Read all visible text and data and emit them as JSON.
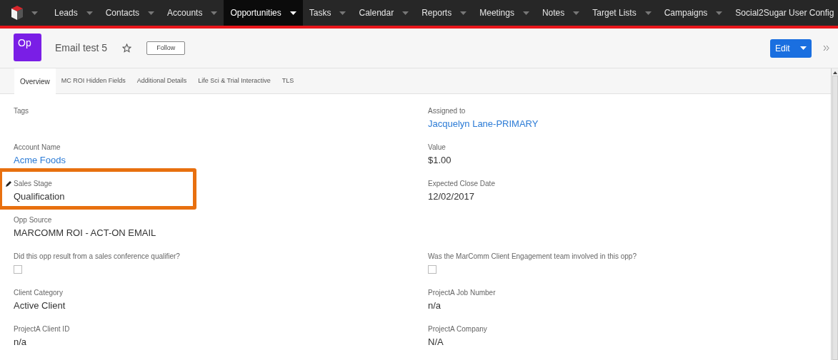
{
  "nav": {
    "items": [
      {
        "label": "Leads",
        "selected": false
      },
      {
        "label": "Contacts",
        "selected": false
      },
      {
        "label": "Accounts",
        "selected": false
      },
      {
        "label": "Opportunities",
        "selected": true
      },
      {
        "label": "Tasks",
        "selected": false
      },
      {
        "label": "Calendar",
        "selected": false
      },
      {
        "label": "Reports",
        "selected": false
      },
      {
        "label": "Meetings",
        "selected": false
      },
      {
        "label": "Notes",
        "selected": false
      },
      {
        "label": "Target Lists",
        "selected": false
      },
      {
        "label": "Campaigns",
        "selected": false
      },
      {
        "label": "Social2Sugar User Config",
        "selected": false
      }
    ]
  },
  "header": {
    "badge": "Op",
    "title": "Email test 5",
    "starred": false,
    "follow_button": "Follow",
    "edit_button": "Edit"
  },
  "tabs": [
    {
      "label": "Overview",
      "selected": true
    },
    {
      "label": "MC ROI Hidden Fields",
      "selected": false
    },
    {
      "label": "Additional Details",
      "selected": false
    },
    {
      "label": "Life Sci & Trial Interactive",
      "selected": false
    },
    {
      "label": "TLS",
      "selected": false
    }
  ],
  "rows": [
    {
      "left": {
        "label": "Tags",
        "kind": "text",
        "highlighted": false
      },
      "right": {
        "label": "Assigned to",
        "kind": "link",
        "value": "Jacquelyn Lane-PRIMARY",
        "highlighted": false
      }
    },
    {
      "left": {
        "label": "Account Name",
        "kind": "link",
        "value": "Acme Foods",
        "highlighted": false
      },
      "right": {
        "label": "Value",
        "kind": "text",
        "value": "$1.00",
        "highlighted": false
      }
    },
    {
      "left": {
        "label": "Sales Stage",
        "kind": "text",
        "value": "Qualification",
        "highlighted": true
      },
      "right": {
        "label": "Expected Close Date",
        "kind": "text",
        "value": "12/02/2017",
        "highlighted": false
      }
    },
    {
      "left": {
        "label": "Opp Source",
        "kind": "text",
        "value": "MARCOMM ROI - ACT-ON EMAIL",
        "highlighted": false
      }
    },
    {
      "left": {
        "label": "Did this opp result from a sales conference qualifier?",
        "kind": "checkbox",
        "checked": false,
        "highlighted": false
      },
      "right": {
        "label": "Was the MarComm Client Engagement team involved in this opp?",
        "kind": "checkbox",
        "checked": false,
        "highlighted": false
      }
    },
    {
      "left": {
        "label": "Client Category",
        "kind": "text",
        "value": "Active Client",
        "highlighted": false
      },
      "right": {
        "label": "ProjectA Job Number",
        "kind": "text",
        "value": "n/a",
        "highlighted": false
      }
    },
    {
      "left": {
        "label": "ProjectA Client ID",
        "kind": "text",
        "value": "n/a",
        "highlighted": false
      },
      "right": {
        "label": "ProjectA Company",
        "kind": "text",
        "value": "N/A",
        "highlighted": false
      }
    }
  ]
}
